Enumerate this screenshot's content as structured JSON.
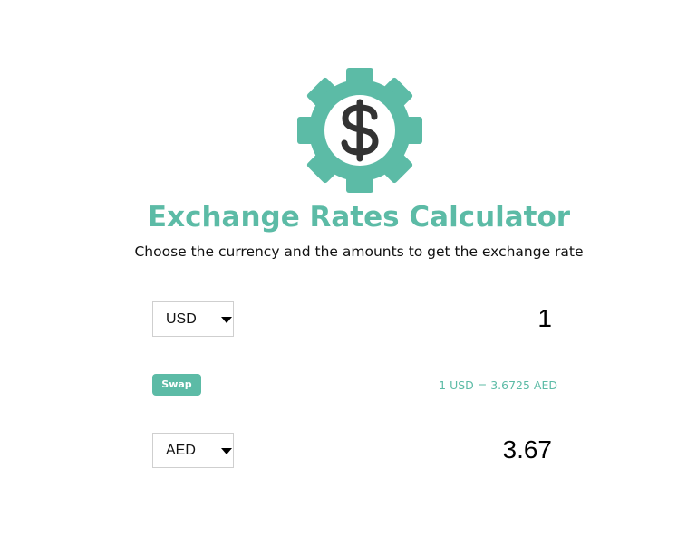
{
  "header": {
    "logo_icon": "dollar-gear-icon",
    "title": "Exchange Rates Calculator",
    "subtitle": "Choose the currency and the amounts to get the exchange rate"
  },
  "currency_one": {
    "selected": "USD",
    "amount": "1"
  },
  "swap": {
    "label": "Swap"
  },
  "rate": {
    "text": "1 USD = 3.6725 AED"
  },
  "currency_two": {
    "selected": "AED",
    "amount": "3.67"
  },
  "colors": {
    "accent": "#5cbba6",
    "text": "#111111",
    "background": "#ffffff"
  }
}
